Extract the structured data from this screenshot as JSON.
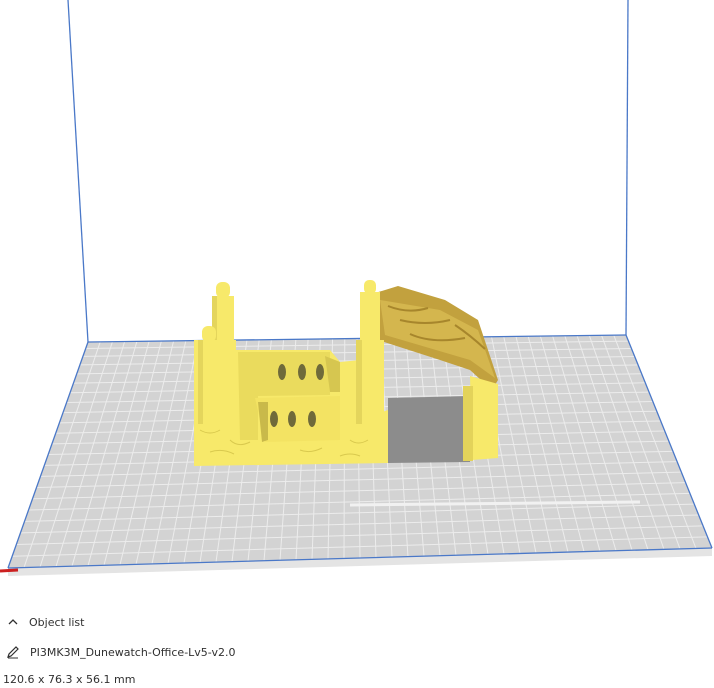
{
  "object_list": {
    "header_label": "Object list",
    "toggle_icon": "chevron-up-icon"
  },
  "object": {
    "name": "PI3MK3M_Dunewatch-Office-Lv5-v2.0",
    "edit_icon": "pencil-icon",
    "dimensions": "120.6 x 76.3 x 56.1 mm"
  },
  "colors": {
    "build_plate": "#d3d3d3",
    "grid_line": "#eaeaea",
    "volume_edge": "#4a78c8",
    "model": "#f7e96a",
    "model_shadow": "#c9b94a",
    "model_roof": "#c2a13e",
    "overhang": "#8c8c8c",
    "x_axis": "#cc2020"
  }
}
